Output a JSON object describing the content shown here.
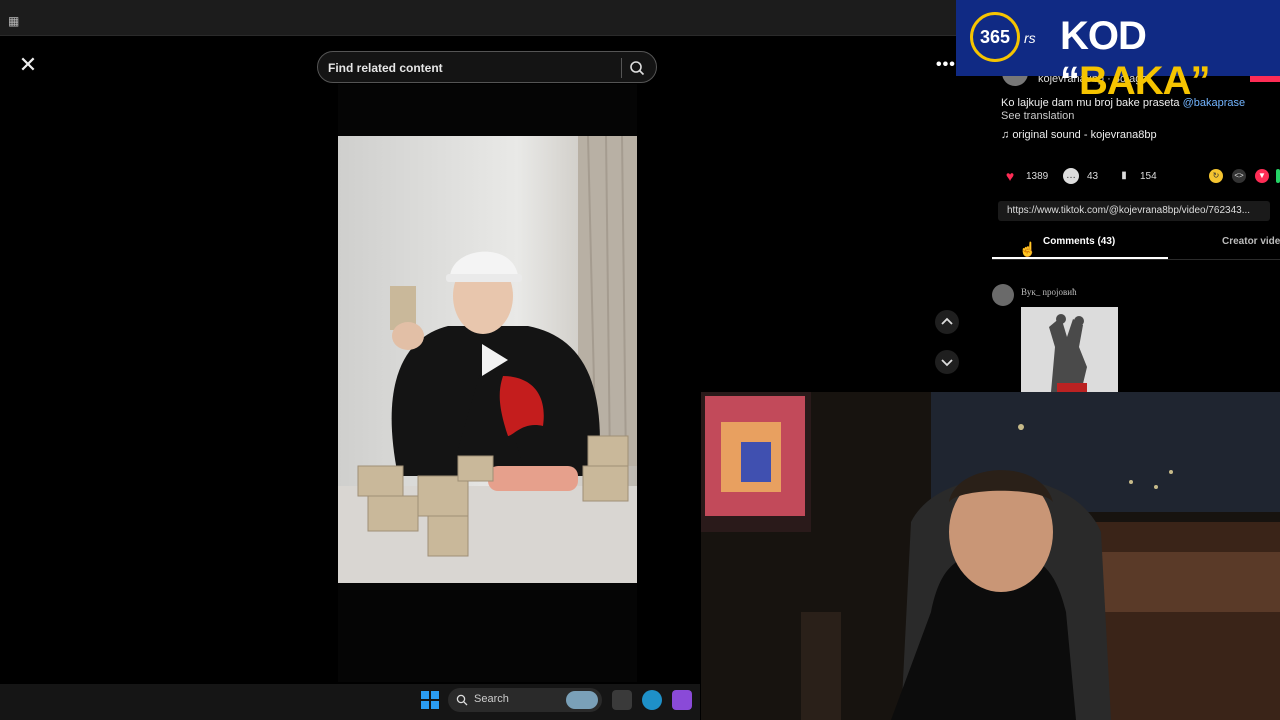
{
  "viewer": {
    "close_label": "✕",
    "search_placeholder": "Find related content",
    "more_label": "•••",
    "nav_up": "⌃",
    "nav_down": "⌄",
    "play_label": "Play"
  },
  "banner": {
    "logo_text": "365",
    "logo_suffix": "rs",
    "headline_prefix": "KOD “",
    "headline_highlight": "BAKA",
    "headline_suffix": "”"
  },
  "post": {
    "author_line": "kojevrana8bp · 3d ago",
    "caption": "Ko lajkuje dam mu broj bake praseta ",
    "mention": "@bakaprase",
    "see_translation": "See translation",
    "sound": "original sound - kojevrana8bp",
    "likes": "1389",
    "comments_count": "43",
    "saves": "154",
    "url": "https://www.tiktok.com/@kojevrana8bp/video/762343..."
  },
  "tabs": [
    {
      "label": "Comments (43)",
      "active": true
    },
    {
      "label": "Creator vide",
      "active": false
    }
  ],
  "comment": {
    "author": "Вук_ npojoвић"
  },
  "taskbar": {
    "search_label": "Search"
  },
  "colors": {
    "banner_bg": "#102a84",
    "banner_accent": "#f6c400",
    "mention": "#73b5ff",
    "like_heart": "#fe2c55"
  }
}
